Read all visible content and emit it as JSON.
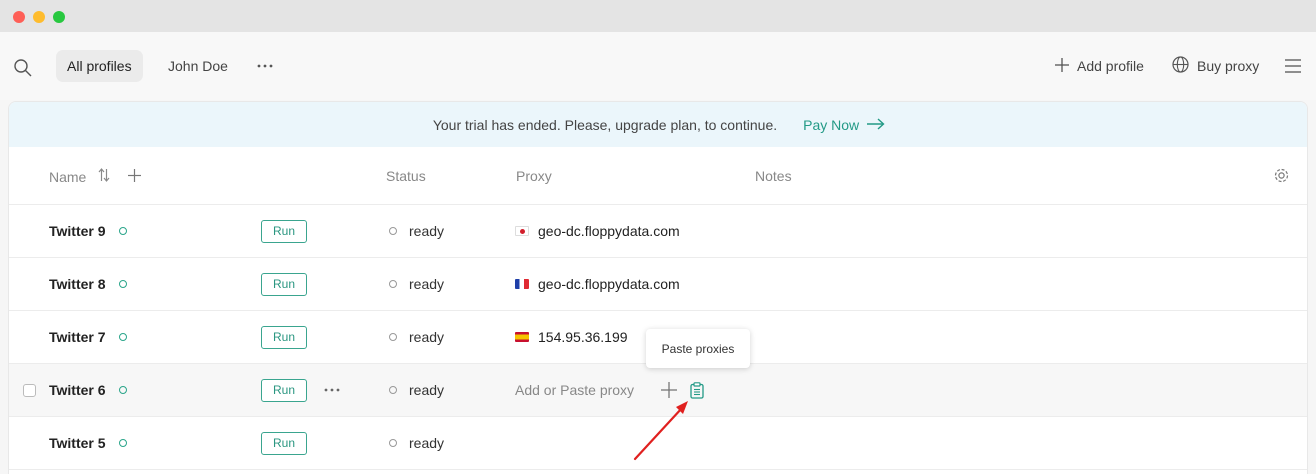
{
  "toolbar": {
    "tabs": [
      {
        "label": "All profiles",
        "active": true
      },
      {
        "label": "John Doe",
        "active": false
      }
    ],
    "add_profile": "Add profile",
    "buy_proxy": "Buy proxy"
  },
  "banner": {
    "message": "Your trial has ended. Please, upgrade plan, to continue.",
    "action": "Pay Now"
  },
  "table": {
    "columns": {
      "name": "Name",
      "status": "Status",
      "proxy": "Proxy",
      "notes": "Notes"
    },
    "rows": [
      {
        "name": "Twitter 9",
        "run": "Run",
        "status": "ready",
        "proxy": "geo-dc.floppydata.com",
        "flag": "japan"
      },
      {
        "name": "Twitter 8",
        "run": "Run",
        "status": "ready",
        "proxy": "geo-dc.floppydata.com",
        "flag": "france"
      },
      {
        "name": "Twitter 7",
        "run": "Run",
        "status": "ready",
        "proxy": "154.95.36.199",
        "flag": "spain"
      },
      {
        "name": "Twitter 6",
        "run": "Run",
        "status": "ready",
        "proxy_placeholder": "Add or Paste proxy"
      },
      {
        "name": "Twitter 5",
        "run": "Run",
        "status": "ready"
      }
    ]
  },
  "tooltip": {
    "text": "Paste proxies"
  },
  "colors": {
    "accent": "#239a86",
    "banner_bg": "#ebf6fb",
    "arrow": "#e0201f"
  },
  "icons": [
    "search-icon",
    "more-horizontal-icon",
    "plus-icon",
    "globe-icon",
    "hamburger-menu-icon",
    "arrow-right-icon",
    "sort-icon",
    "gear-icon",
    "clipboard-icon"
  ]
}
